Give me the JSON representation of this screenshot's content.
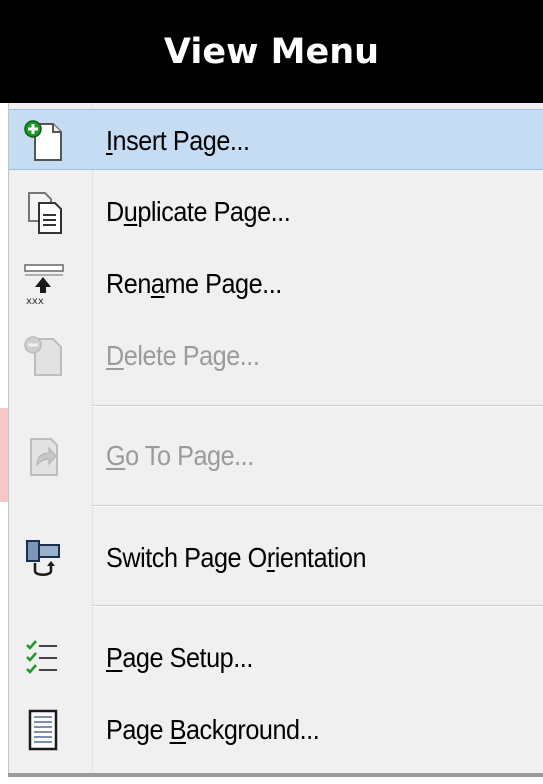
{
  "title": "View Menu",
  "menu": {
    "items": [
      {
        "pre": "",
        "key": "I",
        "post": "nsert Page...",
        "icon": "insert-page-icon",
        "state": "highlighted"
      },
      {
        "pre": "D",
        "key": "u",
        "post": "plicate Page...",
        "icon": "duplicate-page-icon",
        "state": "enabled"
      },
      {
        "pre": "Ren",
        "key": "a",
        "post": "me Page...",
        "icon": "rename-page-icon",
        "state": "enabled"
      },
      {
        "pre": "",
        "key": "D",
        "post": "elete Page...",
        "icon": "delete-page-icon",
        "state": "disabled"
      },
      {
        "pre": "",
        "key": "G",
        "post": "o To Page...",
        "icon": "go-to-page-icon",
        "state": "disabled"
      },
      {
        "pre": "Switch Page O",
        "key": "r",
        "post": "ientation",
        "icon": "switch-orientation-icon",
        "state": "enabled"
      },
      {
        "pre": "",
        "key": "P",
        "post": "age Setup...",
        "icon": "page-setup-icon",
        "state": "enabled"
      },
      {
        "pre": "Page ",
        "key": "B",
        "post": "ackground...",
        "icon": "page-background-icon",
        "state": "enabled"
      }
    ]
  },
  "colors": {
    "highlight": "#c6dcf2",
    "disabled_text": "#9b9b9b",
    "menu_bg": "#f0f0f0",
    "header_bg": "#000000"
  }
}
